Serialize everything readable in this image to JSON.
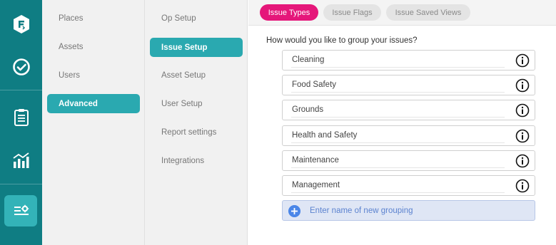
{
  "rail": {
    "icons": [
      "app-logo-icon",
      "check-circle-icon",
      "clipboard-icon",
      "chart-icon",
      "settings-sliders-icon"
    ],
    "accent": "#0f7d83",
    "active_color": "#33b3b8"
  },
  "nav1": {
    "items": [
      {
        "label": "Places"
      },
      {
        "label": "Assets"
      },
      {
        "label": "Users"
      },
      {
        "label": "Advanced"
      }
    ]
  },
  "nav2": {
    "items": [
      {
        "label": "Op Setup"
      },
      {
        "label": "Issue Setup"
      },
      {
        "label": "Asset Setup"
      },
      {
        "label": "User Setup"
      },
      {
        "label": "Report settings"
      },
      {
        "label": "Integrations"
      }
    ]
  },
  "tabs": [
    {
      "label": "Issue Types"
    },
    {
      "label": "Issue Flags"
    },
    {
      "label": "Issue Saved Views"
    }
  ],
  "main": {
    "question": "How would you like to group your issues?",
    "groupings": [
      {
        "label": "Cleaning"
      },
      {
        "label": "Food Safety"
      },
      {
        "label": "Grounds"
      },
      {
        "label": "Health and Safety"
      },
      {
        "label": "Maintenance"
      },
      {
        "label": "Management"
      }
    ],
    "new_grouping_placeholder": "Enter name of new grouping"
  },
  "colors": {
    "tab_active": "#e5177a",
    "nav_active": "#2aa9b0",
    "add_button": "#4a86e8"
  }
}
